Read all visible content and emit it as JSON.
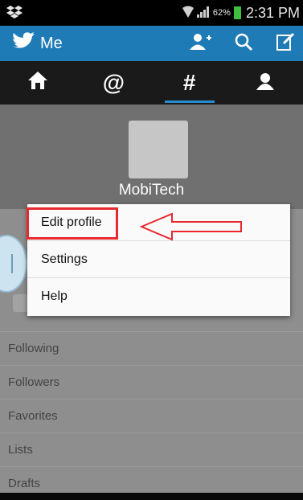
{
  "status_bar": {
    "battery_percent": "62%",
    "time": "2:31 PM",
    "icons": [
      "dropbox-icon",
      "wifi-icon",
      "signal-icon",
      "battery-icon"
    ]
  },
  "action_bar": {
    "title": "Me",
    "color": "#1e7bb5",
    "icons": [
      "twitter-bird-icon",
      "add-user-icon",
      "search-icon",
      "compose-icon"
    ]
  },
  "tabs": [
    {
      "icon": "home-icon",
      "glyph": "⌂"
    },
    {
      "icon": "mentions-icon",
      "glyph": "@"
    },
    {
      "icon": "discover-icon",
      "glyph": "#"
    },
    {
      "icon": "profile-icon",
      "glyph": ""
    }
  ],
  "profile": {
    "username": "MobiTech"
  },
  "menu": {
    "items": [
      "Edit profile",
      "Settings",
      "Help"
    ]
  },
  "list": {
    "items": [
      "Following",
      "Followers",
      "Favorites",
      "Lists",
      "Drafts"
    ]
  },
  "annotation": {
    "highlight_color": "#e8282f"
  }
}
